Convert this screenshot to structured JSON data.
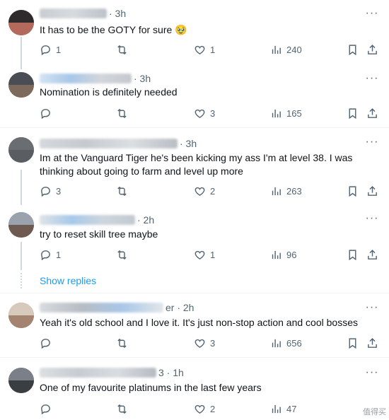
{
  "colors": {
    "accent": "#1d9bf0",
    "muted": "#536471",
    "text": "#0f1419",
    "divider": "#eff3f4"
  },
  "show_replies_label": "Show replies",
  "watermark": "值得买",
  "replies": [
    {
      "time": "· 3h",
      "text": "It has to be the GOTY for sure 🥹",
      "reply_count": "1",
      "repost_count": "",
      "like_count": "1",
      "views": "240"
    },
    {
      "time": "· 3h",
      "text": "Nomination is definitely needed",
      "reply_count": "",
      "repost_count": "",
      "like_count": "3",
      "views": "165"
    },
    {
      "time": "· 3h",
      "text": "Im at the Vanguard Tiger he's been kicking my ass I'm at level 38. I was thinking about going to farm and level up more",
      "reply_count": "3",
      "repost_count": "",
      "like_count": "2",
      "views": "263"
    },
    {
      "time": "· 2h",
      "text": "try to reset skill tree maybe",
      "reply_count": "1",
      "repost_count": "",
      "like_count": "1",
      "views": "96"
    },
    {
      "time": "er · 2h",
      "text": "Yeah it's old school and I love it. It's just non-stop action and cool bosses",
      "reply_count": "",
      "repost_count": "",
      "like_count": "3",
      "views": "656"
    },
    {
      "time": "3 · 1h",
      "text": "One of my favourite platinums in the last few years",
      "reply_count": "",
      "repost_count": "",
      "like_count": "2",
      "views": "47"
    }
  ]
}
